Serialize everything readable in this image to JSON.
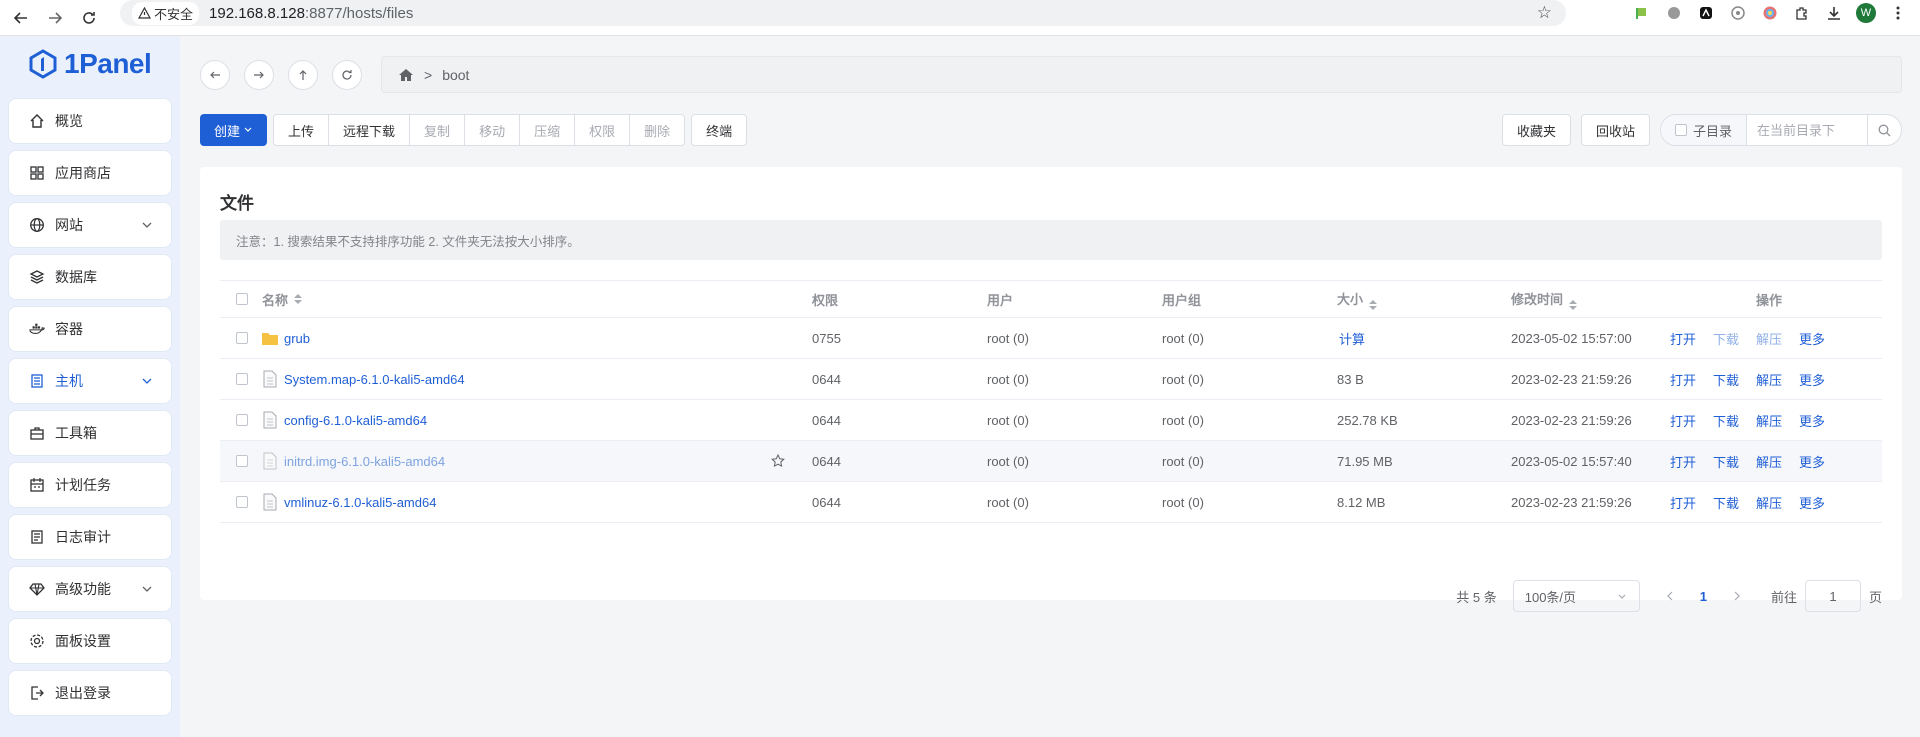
{
  "browser": {
    "security_label": "不安全",
    "url_host": "192.168.8.128",
    "url_rest": ":8877/hosts/files",
    "avatar_letter": "W"
  },
  "sidebar": {
    "logo_text": "1Panel",
    "items": [
      {
        "label": "概览",
        "icon": "home-icon",
        "has_chevron": false
      },
      {
        "label": "应用商店",
        "icon": "apps-grid-icon",
        "has_chevron": false
      },
      {
        "label": "网站",
        "icon": "globe-icon",
        "has_chevron": true
      },
      {
        "label": "数据库",
        "icon": "layers-icon",
        "has_chevron": false
      },
      {
        "label": "容器",
        "icon": "docker-icon",
        "has_chevron": false
      },
      {
        "label": "主机",
        "icon": "server-icon",
        "has_chevron": true,
        "active": true
      },
      {
        "label": "工具箱",
        "icon": "toolbox-icon",
        "has_chevron": false
      },
      {
        "label": "计划任务",
        "icon": "calendar-icon",
        "has_chevron": false
      },
      {
        "label": "日志审计",
        "icon": "log-icon",
        "has_chevron": false
      },
      {
        "label": "高级功能",
        "icon": "diamond-icon",
        "has_chevron": true
      },
      {
        "label": "面板设置",
        "icon": "gear-icon",
        "has_chevron": false
      },
      {
        "label": "退出登录",
        "icon": "logout-icon",
        "has_chevron": false
      }
    ]
  },
  "path": {
    "segments": [
      "boot"
    ]
  },
  "toolbar": {
    "create_label": "创建",
    "upload_label": "上传",
    "remote_download_label": "远程下载",
    "copy_label": "复制",
    "move_label": "移动",
    "compress_label": "压缩",
    "permission_label": "权限",
    "delete_label": "删除",
    "terminal_label": "终端",
    "favorites_label": "收藏夹",
    "recycle_label": "回收站",
    "subdir_label": "子目录",
    "search_placeholder": "在当前目录下"
  },
  "card": {
    "title": "文件",
    "notice": "注意：1. 搜索结果不支持排序功能 2. 文件夹无法按大小排序。"
  },
  "table": {
    "columns": {
      "name": "名称",
      "permission": "权限",
      "user": "用户",
      "group": "用户组",
      "size": "大小",
      "modified": "修改时间",
      "actions": "操作"
    },
    "actions": {
      "open": "打开",
      "download": "下载",
      "extract": "解压",
      "more": "更多"
    },
    "rows": [
      {
        "name": "grub",
        "type": "folder",
        "permission": "0755",
        "user": "root (0)",
        "group": "root (0)",
        "size": "计算",
        "modified": "2023-05-02 15:57:00"
      },
      {
        "name": "System.map-6.1.0-kali5-amd64",
        "type": "file",
        "permission": "0644",
        "user": "root (0)",
        "group": "root (0)",
        "size": "83 B",
        "modified": "2023-02-23 21:59:26"
      },
      {
        "name": "config-6.1.0-kali5-amd64",
        "type": "file",
        "permission": "0644",
        "user": "root (0)",
        "group": "root (0)",
        "size": "252.78 KB",
        "modified": "2023-02-23 21:59:26"
      },
      {
        "name": "initrd.img-6.1.0-kali5-amd64",
        "type": "file",
        "permission": "0644",
        "user": "root (0)",
        "group": "root (0)",
        "size": "71.95 MB",
        "modified": "2023-05-02 15:57:40"
      },
      {
        "name": "vmlinuz-6.1.0-kali5-amd64",
        "type": "file",
        "permission": "0644",
        "user": "root (0)",
        "group": "root (0)",
        "size": "8.12 MB",
        "modified": "2023-02-23 21:59:26"
      }
    ]
  },
  "pagination": {
    "total_label": "共 5 条",
    "page_size_label": "100条/页",
    "current_page": "1",
    "goto_label": "前往",
    "goto_value": "1",
    "page_unit": "页"
  },
  "colors": {
    "accent": "#1f5fd6",
    "sidebar_bg": "#eaf1fc",
    "folder": "#f5c242"
  }
}
